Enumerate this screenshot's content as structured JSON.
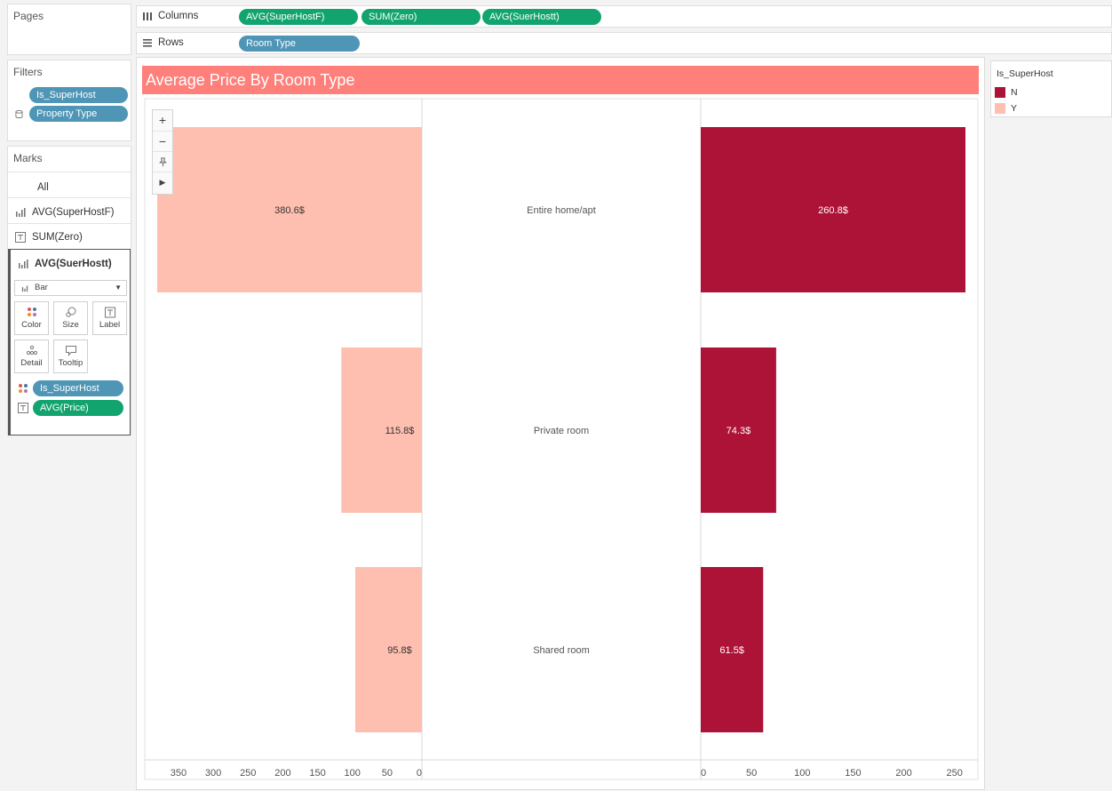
{
  "pages": {
    "title": "Pages"
  },
  "shelves": {
    "columns_label": "Columns",
    "rows_label": "Rows",
    "columns": [
      "AVG(SuperHostF)",
      "SUM(Zero)",
      "AVG(SuerHostt)"
    ],
    "rows": [
      "Room Type"
    ]
  },
  "filters": {
    "title": "Filters",
    "items": [
      "Is_SuperHost",
      "Property Type"
    ]
  },
  "marks": {
    "title": "Marks",
    "all": "All",
    "measures": [
      "AVG(SuperHostF)",
      "SUM(Zero)",
      "AVG(SuerHostt)"
    ],
    "mark_type": "Bar",
    "cards": [
      "Color",
      "Size",
      "Label",
      "Detail",
      "Tooltip"
    ],
    "fields": [
      "Is_SuperHost",
      "AVG(Price)"
    ]
  },
  "legend": {
    "title": "Is_SuperHost",
    "items": [
      {
        "label": "N",
        "color": "#ad1237"
      },
      {
        "label": "Y",
        "color": "#febfb0"
      }
    ]
  },
  "chart_data": {
    "type": "bar",
    "title": "Average Price By Room Type",
    "categories": [
      "Entire home/apt",
      "Private room",
      "Shared room"
    ],
    "series": [
      {
        "name": "Y",
        "color": "#febfb0",
        "values": [
          380.6,
          115.8,
          95.8
        ],
        "labels": [
          "380.6$",
          "115.8$",
          "95.8$"
        ]
      },
      {
        "name": "N",
        "color": "#ad1237",
        "values": [
          260.8,
          74.3,
          61.5
        ],
        "labels": [
          "260.8$",
          "74.3$",
          "61.5$"
        ]
      }
    ],
    "left_axis": {
      "ticks": [
        350,
        300,
        250,
        200,
        150,
        100,
        50,
        0
      ],
      "reversed": true
    },
    "right_axis": {
      "ticks": [
        0,
        50,
        100,
        150,
        200,
        250
      ]
    }
  }
}
